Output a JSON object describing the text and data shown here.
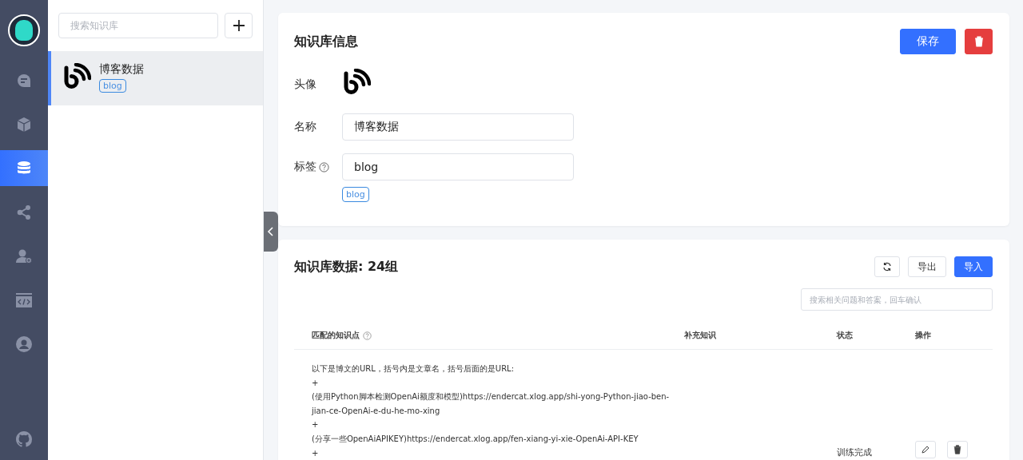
{
  "nav": {
    "items": [
      {
        "selected": false
      },
      {
        "selected": false
      },
      {
        "selected": true
      },
      {
        "selected": false
      },
      {
        "selected": false
      },
      {
        "selected": false
      },
      {
        "selected": false
      }
    ]
  },
  "kb_list": {
    "search": {
      "placeholder": "搜索知识库"
    },
    "items": [
      {
        "name": "博客数据",
        "tag": "blog",
        "selected": true
      }
    ]
  },
  "info": {
    "title": "知识库信息",
    "save": "保存",
    "avatar_label": "头像",
    "name_label": "名称",
    "name_value": "博客数据",
    "tags_label": "标签",
    "tags_value": "blog",
    "tags": [
      "blog"
    ]
  },
  "data": {
    "title": "知识库数据: 24组",
    "export": "导出",
    "import": "导入",
    "search": {
      "placeholder": "搜索相关问题和答案，回车确认"
    },
    "columns": [
      "匹配的知识点",
      "补充知识",
      "状态",
      "操作"
    ],
    "rows": [
      {
        "lines": [
          "以下是博文的URL，括号内是文章名，括号后面的是URL:",
          "+",
          "(使用Python脚本检测OpenAi额度和模型)https://endercat.xlog.app/shi-yong-Python-jiao-ben-",
          "jian-ce-OpenAi-e-du-he-mo-xing",
          "+",
          "(分享一些OpenAiAPIKEY)https://endercat.xlog.app/fen-xiang-yi-xie-OpenAi-API-KEY",
          "+"
        ],
        "status": "训练完成"
      }
    ]
  }
}
